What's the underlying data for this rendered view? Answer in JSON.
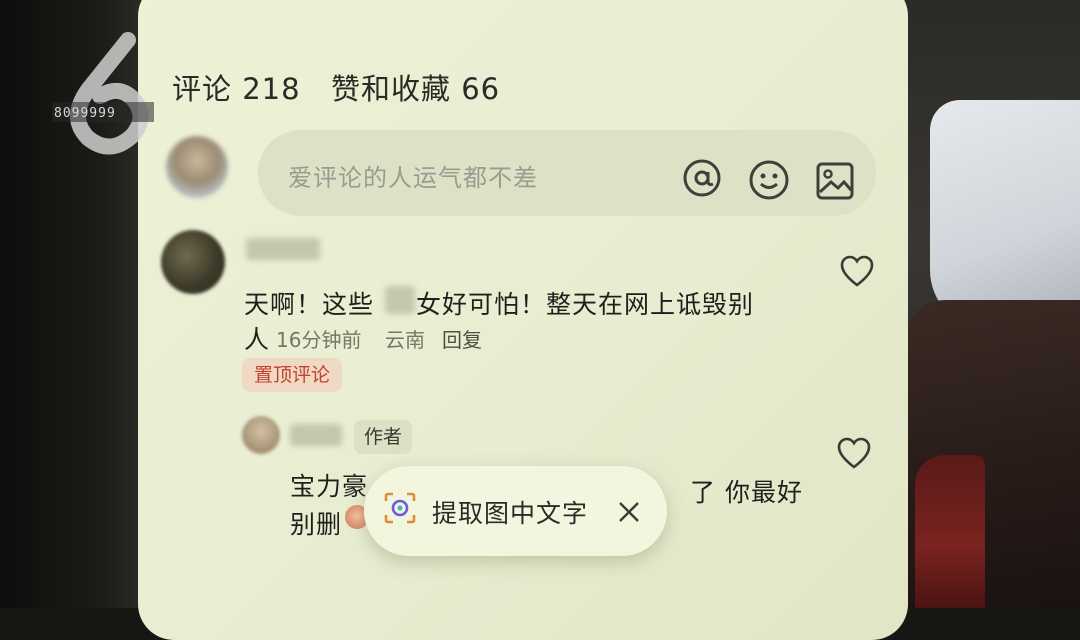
{
  "tabs": {
    "comments": "评论 218",
    "likes": "赞和收藏 66"
  },
  "comment_input": {
    "placeholder": "爱评论的人运气都不差",
    "icons": [
      "at-icon",
      "emoji-icon",
      "image-icon"
    ]
  },
  "comments": [
    {
      "line1_a": "天啊！这些",
      "line1_b": "女好可怕！整天在网上诋毁别",
      "line2": "人",
      "time": "16分钟前",
      "location": "云南",
      "reply": "回复",
      "pinned_label": "置顶评论"
    }
  ],
  "reply": {
    "author_tag": "作者",
    "line1_a": "宝力豪",
    "line1_b": "了 你最好",
    "line2": "别删"
  },
  "popup": {
    "label": "提取图中文字"
  },
  "logo": {
    "number": "8099999"
  },
  "colors": {
    "screen_bg": "#ebefd4",
    "pin_text": "#c2402e",
    "pin_bg": "#efd9c4"
  }
}
